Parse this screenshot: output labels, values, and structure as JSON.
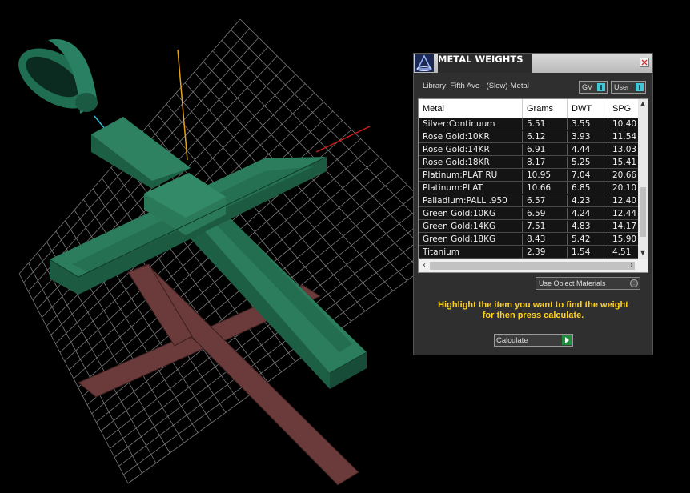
{
  "panel": {
    "title": "METAL WEIGHTS",
    "library_label": "Library: Fifth Ave - (Slow)-Metal",
    "gv_label": "GV",
    "user_label": "User",
    "columns": [
      "Metal",
      "Grams",
      "DWT",
      "SPG"
    ],
    "rows": [
      [
        "Silver:Continuum",
        "5.51",
        "3.55",
        "10.40"
      ],
      [
        "Rose Gold:10KR",
        "6.12",
        "3.93",
        "11.54"
      ],
      [
        "Rose Gold:14KR",
        "6.91",
        "4.44",
        "13.03"
      ],
      [
        "Rose Gold:18KR",
        "8.17",
        "5.25",
        "15.41"
      ],
      [
        "Platinum:PLAT RU",
        "10.95",
        "7.04",
        "20.66"
      ],
      [
        "Platinum:PLAT",
        "10.66",
        "6.85",
        "20.10"
      ],
      [
        "Palladium:PALL .950",
        "6.57",
        "4.23",
        "12.40"
      ],
      [
        "Green Gold:10KG",
        "6.59",
        "4.24",
        "12.44"
      ],
      [
        "Green Gold:14KG",
        "7.51",
        "4.83",
        "14.17"
      ],
      [
        "Green Gold:18KG",
        "8.43",
        "5.42",
        "15.90"
      ],
      [
        "Titanium",
        "2.39",
        "1.54",
        "4.51"
      ]
    ],
    "use_object_materials_label": "Use Object Materials",
    "instruction_line1": "Highlight the item you want to find the weight",
    "instruction_line2": "for then press calculate.",
    "calculate_label": "Calculate"
  },
  "colors": {
    "cross_green": "#1f6b4e",
    "shadow": "#6a3b3b",
    "accent_text": "#ffd21a",
    "toggle_on": "#3fc8d8"
  }
}
